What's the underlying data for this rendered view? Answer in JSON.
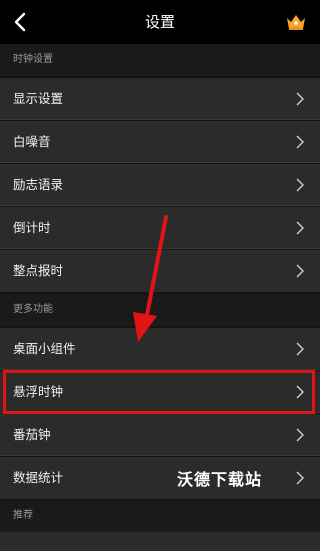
{
  "header": {
    "title": "设置",
    "back_icon": "chevron-left-icon",
    "vip_icon": "crown-icon"
  },
  "sections": {
    "clock": "时钟设置",
    "more": "更多功能",
    "recommend": "推荐"
  },
  "items": {
    "display": "显示设置",
    "white_noise": "白噪音",
    "motivation": "励志语录",
    "countdown": "倒计时",
    "hourly_chime": "整点报时",
    "widget": "桌面小组件",
    "floating_clock": "悬浮时钟",
    "pomodoro": "番茄钟",
    "statistics": "数据统计"
  },
  "overlay": {
    "watermark": "沃德下载站",
    "highlight_color": "#e11414",
    "arrow_color": "#e11414"
  }
}
